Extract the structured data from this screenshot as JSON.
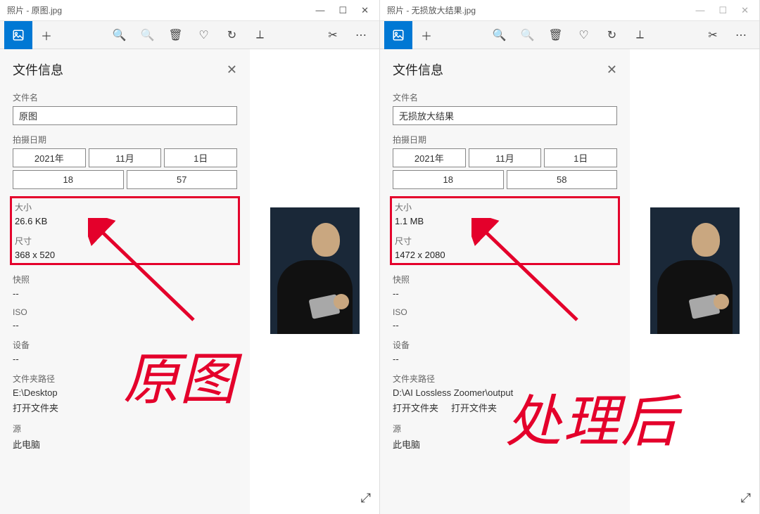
{
  "windows": [
    {
      "title": "照片 - 原图.jpg",
      "panel": {
        "heading": "文件信息",
        "filename_label": "文件名",
        "filename": "原图",
        "date_label": "拍摄日期",
        "year": "2021年",
        "month": "11月",
        "day": "1日",
        "hour": "18",
        "minute": "57",
        "size_label": "大小",
        "size": "26.6 KB",
        "dim_label": "尺寸",
        "dim": "368 x 520",
        "snapshot_label": "快照",
        "snapshot": "--",
        "iso_label": "ISO",
        "iso": "--",
        "device_label": "设备",
        "device": "--",
        "folder_label": "文件夹路径",
        "folder": "E:\\Desktop",
        "open_link": "打开文件夹",
        "source_label": "源",
        "source": "此电脑"
      },
      "annotation": "原图"
    },
    {
      "title": "照片 - 无损放大结果.jpg",
      "panel": {
        "heading": "文件信息",
        "filename_label": "文件名",
        "filename": "无损放大结果",
        "date_label": "拍摄日期",
        "year": "2021年",
        "month": "11月",
        "day": "1日",
        "hour": "18",
        "minute": "58",
        "size_label": "大小",
        "size": "1.1 MB",
        "dim_label": "尺寸",
        "dim": "1472 x 2080",
        "snapshot_label": "快照",
        "snapshot": "--",
        "iso_label": "ISO",
        "iso": "--",
        "device_label": "设备",
        "device": "--",
        "folder_label": "文件夹路径",
        "folder": "D:\\AI Lossless Zoomer\\output",
        "open_link": "打开文件夹",
        "open_link2": "打开文件夹",
        "source_label": "源",
        "source": "此电脑"
      },
      "annotation": "处理后"
    }
  ],
  "win_controls": {
    "min": "—",
    "max": "☐",
    "close": "✕"
  }
}
